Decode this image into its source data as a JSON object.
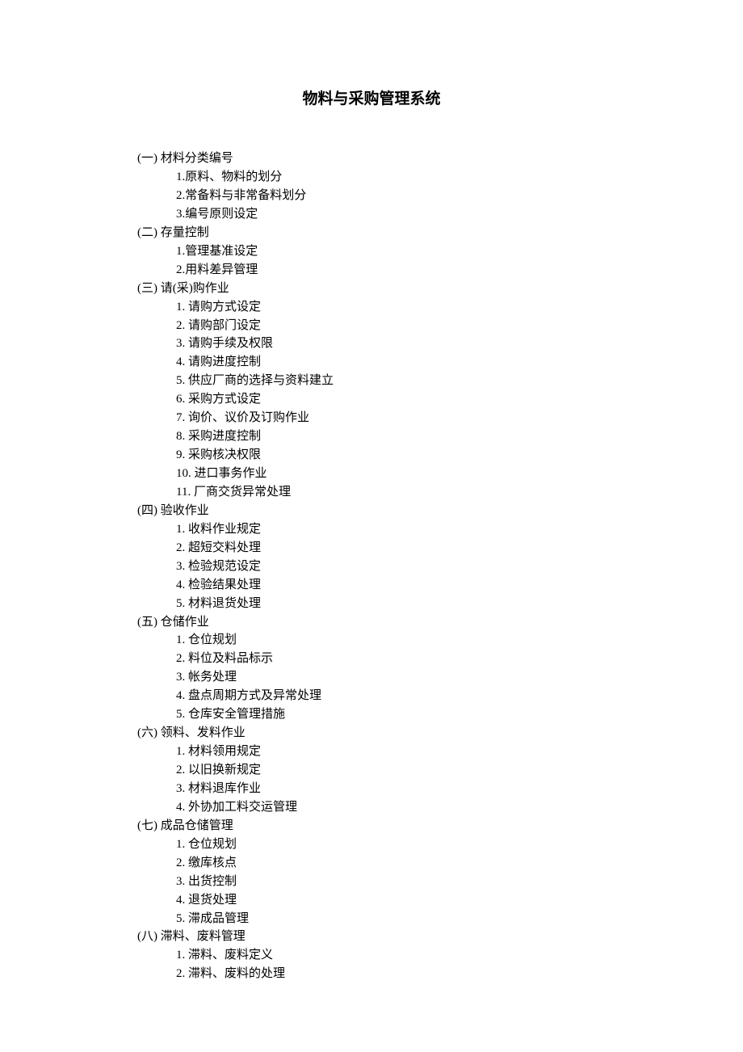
{
  "title": "物料与采购管理系统",
  "sections": [
    {
      "header": "(一) 材料分类编号",
      "style": "a",
      "items": [
        "1.原料、物料的划分",
        "2.常备料与非常备料划分",
        "3.编号原则设定"
      ]
    },
    {
      "header": "(二) 存量控制",
      "style": "a",
      "items": [
        "1.管理基准设定",
        "2.用料差异管理"
      ]
    },
    {
      "header": "(三) 请(采)购作业",
      "style": "b",
      "items": [
        "1. 请购方式设定",
        "2. 请购部门设定",
        "3. 请购手续及权限",
        "4. 请购进度控制",
        "5. 供应厂商的选择与资料建立",
        "6. 采购方式设定",
        "7. 询价、议价及订购作业",
        "8. 采购进度控制",
        "9. 采购核决权限",
        "10. 进口事务作业",
        "11. 厂商交货异常处理"
      ]
    },
    {
      "header": "(四) 验收作业",
      "style": "b",
      "items": [
        "1. 收料作业规定",
        "2. 超短交料处理",
        "3. 检验规范设定",
        "4. 检验结果处理",
        "5. 材料退货处理"
      ]
    },
    {
      "header": "(五) 仓储作业",
      "style": "b",
      "items": [
        "1. 仓位规划",
        "2. 料位及料品标示",
        "3. 帐务处理",
        "4. 盘点周期方式及异常处理",
        "5. 仓库安全管理措施"
      ]
    },
    {
      "header": "(六) 领料、发料作业",
      "style": "b",
      "items": [
        "1. 材料领用规定",
        "2. 以旧换新规定",
        "3. 材料退库作业",
        "4. 外协加工料交运管理"
      ]
    },
    {
      "header": "(七) 成品仓储管理",
      "style": "b",
      "items": [
        "1. 仓位规划",
        "2. 缴库核点",
        "3. 出货控制",
        "4. 退货处理",
        "5. 滞成品管理"
      ]
    },
    {
      "header": "(八) 滞料、废料管理",
      "style": "b",
      "items": [
        "1. 滞料、废料定义",
        "2. 滞料、废料的处理"
      ]
    }
  ]
}
